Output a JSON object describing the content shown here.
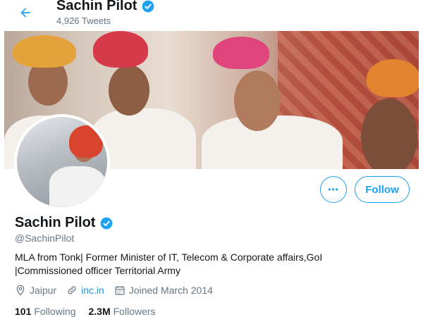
{
  "header": {
    "name": "Sachin Pilot",
    "tweet_count": "4,926 Tweets",
    "back_icon": "back-arrow-icon"
  },
  "profile": {
    "name": "Sachin Pilot",
    "handle": "@SachinPilot",
    "bio": "MLA from Tonk| Former Minister of IT, Telecom & Corporate affairs,GoI |Commissioned officer Territorial Army",
    "location": "Jaipur",
    "website": "inc.in",
    "joined": "Joined March 2014",
    "following_count": "101",
    "following_label": "Following",
    "followers_count": "2.3M",
    "followers_label": "Followers"
  },
  "actions": {
    "follow_label": "Follow",
    "more_label": "•••"
  },
  "colors": {
    "accent": "#1da1f2",
    "verified": "#1da1f2",
    "secondary_text": "#657786"
  }
}
